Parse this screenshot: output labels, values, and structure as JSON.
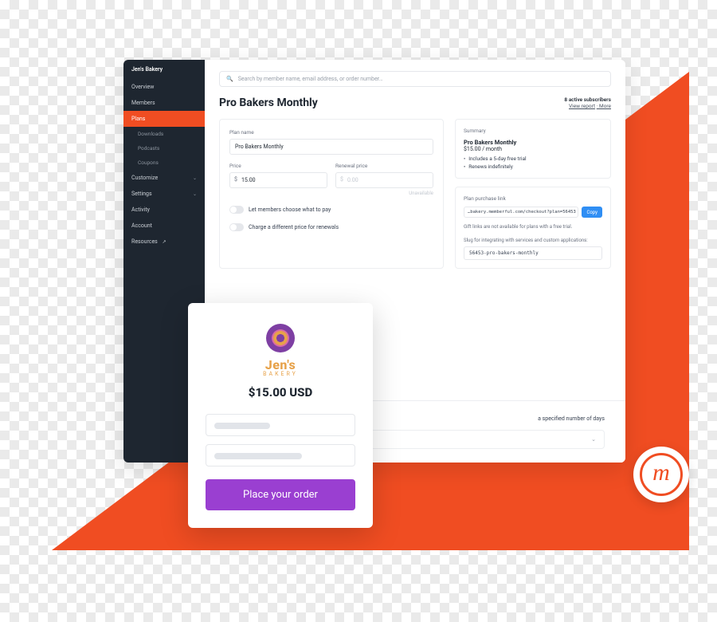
{
  "sidebar": {
    "title": "Jen's Bakery",
    "items": [
      {
        "label": "Overview"
      },
      {
        "label": "Members"
      },
      {
        "label": "Plans",
        "active": true
      },
      {
        "label": "Downloads",
        "sub": true
      },
      {
        "label": "Podcasts",
        "sub": true
      },
      {
        "label": "Coupons",
        "sub": true
      },
      {
        "label": "Customize",
        "expandable": true
      },
      {
        "label": "Settings",
        "expandable": true
      },
      {
        "label": "Activity"
      },
      {
        "label": "Account"
      },
      {
        "label": "Resources",
        "external": true
      }
    ]
  },
  "search": {
    "placeholder": "Search by member name, email address, or order number…"
  },
  "page": {
    "title": "Pro Bakers Monthly",
    "subscribers": "8 active subscribers",
    "view_report": "View report",
    "more": "More"
  },
  "form": {
    "plan_name_label": "Plan name",
    "plan_name_value": "Pro Bakers Monthly",
    "price_label": "Price",
    "price_currency": "$",
    "price_value": "15.00",
    "renewal_label": "Renewal price",
    "renewal_currency": "$",
    "renewal_value": "0.00",
    "unavailable": "Unavailable",
    "toggle_choose": "Let members choose what to pay",
    "toggle_renewal": "Charge a different price for renewals"
  },
  "summary": {
    "heading": "Summary",
    "name": "Pro Bakers Monthly",
    "price_line": "$15.00 / month",
    "bullets": [
      "Includes a 5-day free trial",
      "Renews indefinitely"
    ],
    "purchase_label": "Plan purchase link",
    "purchase_link": "…bakery.memberful.com/checkout?plan=56453",
    "copy": "Copy",
    "gift_note": "Gift links are not available for plans with a free trial.",
    "slug_label": "Slug for integrating with services and custom applications:",
    "slug": "56453-pro-bakers-monthly"
  },
  "peek": {
    "line": "a specified number of days"
  },
  "checkout": {
    "brand_top": "Jen's",
    "brand_bottom": "BAKERY",
    "amount": "$15.00 USD",
    "cta": "Place your order"
  },
  "badge": {
    "glyph": "m"
  },
  "colors": {
    "accent": "#f04d22",
    "cta": "#9a3fd1",
    "link_btn": "#2f8ef4"
  }
}
